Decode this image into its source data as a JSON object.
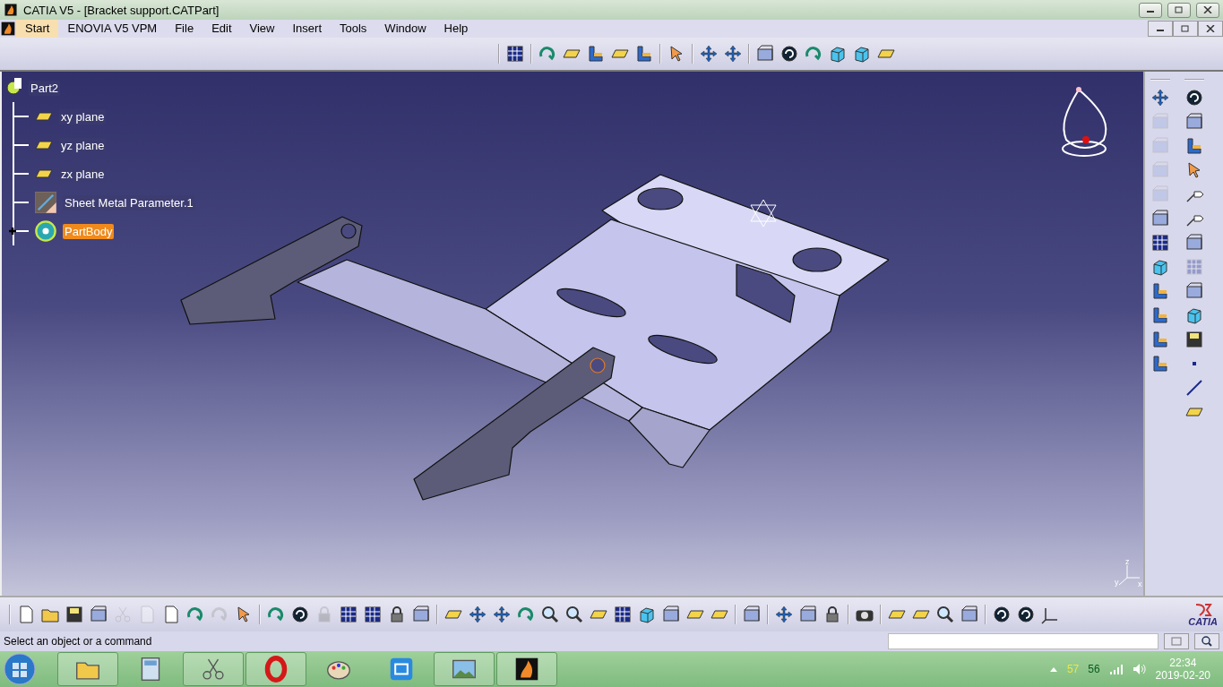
{
  "window": {
    "title": "CATIA V5 - [Bracket support.CATPart]"
  },
  "menu": [
    {
      "label": "Start",
      "selected": true
    },
    {
      "label": "ENOVIA V5 VPM",
      "selected": false
    },
    {
      "label": "File",
      "selected": false
    },
    {
      "label": "Edit",
      "selected": false
    },
    {
      "label": "View",
      "selected": false
    },
    {
      "label": "Insert",
      "selected": false
    },
    {
      "label": "Tools",
      "selected": false
    },
    {
      "label": "Window",
      "selected": false
    },
    {
      "label": "Help",
      "selected": false
    }
  ],
  "top_toolbar": [
    [
      {
        "kind": "grid",
        "disabled": false
      }
    ],
    [
      {
        "kind": "curve",
        "disabled": false
      },
      {
        "kind": "plane",
        "disabled": false
      },
      {
        "kind": "bracket",
        "disabled": false
      },
      {
        "kind": "plane",
        "disabled": false
      },
      {
        "kind": "bracket",
        "disabled": false
      }
    ],
    [
      {
        "kind": "cursor",
        "disabled": false
      }
    ],
    [
      {
        "kind": "arrows",
        "disabled": false
      },
      {
        "kind": "arrows",
        "disabled": false
      }
    ],
    [
      {
        "kind": "box",
        "disabled": false
      },
      {
        "kind": "swirl",
        "disabled": false
      },
      {
        "kind": "curve",
        "disabled": false
      },
      {
        "kind": "cube",
        "disabled": false
      },
      {
        "kind": "cube",
        "disabled": false
      },
      {
        "kind": "plane",
        "disabled": false
      }
    ]
  ],
  "tree": {
    "label": "Part2",
    "selected": false,
    "children": [
      {
        "kind": "plane",
        "label": "xy plane",
        "selected": false
      },
      {
        "kind": "plane",
        "label": "yz plane",
        "selected": false
      },
      {
        "kind": "plane",
        "label": "zx plane",
        "selected": false
      },
      {
        "kind": "parameter",
        "label": "Sheet Metal Parameter.1",
        "selected": false
      },
      {
        "kind": "body",
        "label": "PartBody",
        "selected": true,
        "expanded": false
      }
    ]
  },
  "axis_labels": [
    "z",
    "y",
    "x"
  ],
  "right_toolbar": [
    [
      {
        "kind": "arrows",
        "disabled": false
      },
      {
        "kind": "box",
        "disabled": true
      },
      {
        "kind": "box",
        "disabled": true
      },
      {
        "kind": "box",
        "disabled": true
      },
      {
        "kind": "box",
        "disabled": true
      },
      {
        "kind": "box",
        "disabled": false
      },
      {
        "kind": "grid",
        "disabled": false
      },
      {
        "kind": "cube",
        "disabled": false
      },
      {
        "kind": "bracket",
        "disabled": false
      },
      {
        "kind": "bracket",
        "disabled": false
      },
      {
        "kind": "bracket",
        "disabled": false
      },
      {
        "kind": "bracket",
        "disabled": false
      }
    ],
    [
      {
        "kind": "swirl",
        "disabled": false
      },
      {
        "kind": "box",
        "disabled": false
      },
      {
        "kind": "bracket",
        "disabled": false
      },
      {
        "kind": "cursor",
        "disabled": false
      },
      {
        "kind": "leader",
        "disabled": false
      },
      {
        "kind": "leader",
        "disabled": false
      },
      {
        "kind": "box",
        "disabled": false
      },
      {
        "kind": "grid",
        "disabled": true
      },
      {
        "kind": "box",
        "disabled": false
      },
      {
        "kind": "cube",
        "disabled": false
      },
      {
        "kind": "disk",
        "disabled": false
      },
      {
        "kind": "dot",
        "disabled": false
      },
      {
        "kind": "line",
        "disabled": false
      },
      {
        "kind": "plane",
        "disabled": false
      }
    ]
  ],
  "bottom_toolbar": [
    [
      {
        "kind": "doc",
        "disabled": false
      },
      {
        "kind": "folder",
        "disabled": false
      },
      {
        "kind": "disk",
        "disabled": false
      },
      {
        "kind": "box",
        "disabled": false
      },
      {
        "kind": "scissors",
        "disabled": true
      },
      {
        "kind": "doc",
        "disabled": true
      },
      {
        "kind": "doc",
        "disabled": false
      },
      {
        "kind": "curve",
        "disabled": false
      },
      {
        "kind": "curve",
        "disabled": true
      },
      {
        "kind": "cursor",
        "disabled": false
      }
    ],
    [
      {
        "kind": "curve",
        "disabled": false
      },
      {
        "kind": "swirl",
        "disabled": false
      },
      {
        "kind": "lock",
        "disabled": true
      },
      {
        "kind": "grid",
        "disabled": false
      },
      {
        "kind": "grid",
        "disabled": false
      },
      {
        "kind": "lock",
        "disabled": false
      },
      {
        "kind": "box",
        "disabled": false
      }
    ],
    [
      {
        "kind": "plane",
        "disabled": false
      },
      {
        "kind": "arrows",
        "disabled": false
      },
      {
        "kind": "arrows",
        "disabled": false
      },
      {
        "kind": "curve",
        "disabled": false
      },
      {
        "kind": "magnifier",
        "disabled": false
      },
      {
        "kind": "magnifier",
        "disabled": false
      },
      {
        "kind": "plane",
        "disabled": false
      },
      {
        "kind": "grid",
        "disabled": false
      },
      {
        "kind": "cube",
        "disabled": false
      },
      {
        "kind": "box",
        "disabled": false
      },
      {
        "kind": "plane",
        "disabled": false
      },
      {
        "kind": "plane",
        "disabled": false
      }
    ],
    [
      {
        "kind": "box",
        "disabled": false
      }
    ],
    [
      {
        "kind": "arrows",
        "disabled": false
      },
      {
        "kind": "box",
        "disabled": false
      },
      {
        "kind": "lock",
        "disabled": false
      }
    ],
    [
      {
        "kind": "camera",
        "disabled": false
      }
    ],
    [
      {
        "kind": "plane",
        "disabled": false
      },
      {
        "kind": "plane",
        "disabled": false
      },
      {
        "kind": "magnifier",
        "disabled": false
      },
      {
        "kind": "box",
        "disabled": false
      }
    ],
    [
      {
        "kind": "swirl",
        "disabled": false
      },
      {
        "kind": "swirl",
        "disabled": false
      },
      {
        "kind": "axes",
        "disabled": false
      }
    ]
  ],
  "logo_text": "CATIA",
  "status_bar": {
    "message": "Select an object or a command"
  },
  "taskbar": {
    "apps": [
      {
        "kind": "folder",
        "running": true
      },
      {
        "kind": "calculator",
        "running": false
      },
      {
        "kind": "scissors",
        "running": true
      },
      {
        "kind": "ring",
        "running": true
      },
      {
        "kind": "palette",
        "running": false
      },
      {
        "kind": "screen",
        "running": false
      },
      {
        "kind": "photo",
        "running": true
      },
      {
        "kind": "flame",
        "running": true
      }
    ],
    "tray": {
      "reading_1": "57",
      "reading_2": "56",
      "time": "22:34",
      "date": "2019-02-20"
    }
  }
}
